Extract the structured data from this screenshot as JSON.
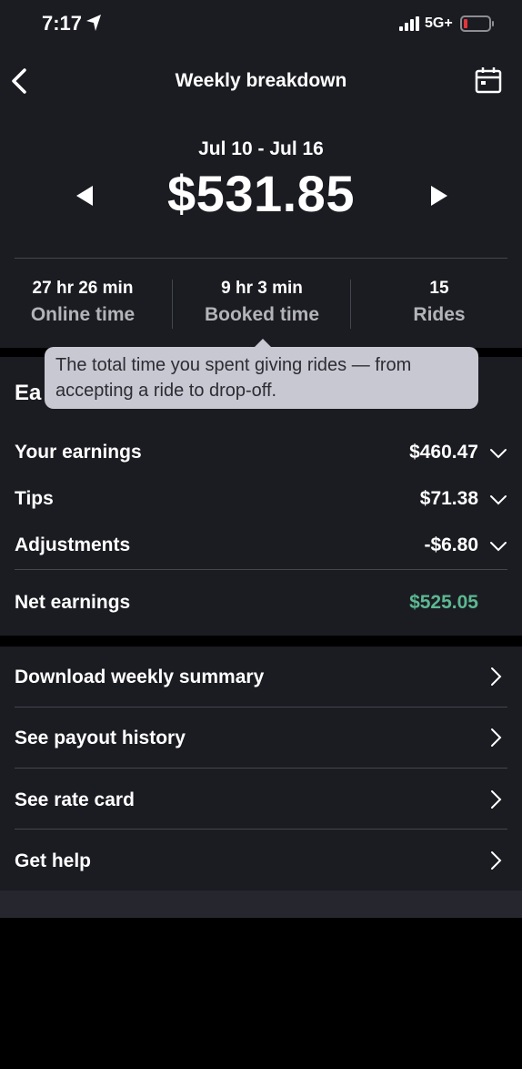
{
  "status": {
    "time": "7:17",
    "network": "5G+"
  },
  "header": {
    "title": "Weekly breakdown"
  },
  "summary": {
    "date_range": "Jul 10 - Jul 16",
    "total": "$531.85"
  },
  "stats": [
    {
      "value": "27 hr 26 min",
      "label": "Online time"
    },
    {
      "value": "9 hr 3 min",
      "label": "Booked time"
    },
    {
      "value": "15",
      "label": "Rides"
    }
  ],
  "tooltip": {
    "text": "The total time you spent giving rides — from accepting a ride to drop-off."
  },
  "earnings": {
    "title": "Ea",
    "rows": [
      {
        "label": "Your earnings",
        "amount": "$460.47"
      },
      {
        "label": "Tips",
        "amount": "$71.38"
      },
      {
        "label": "Adjustments",
        "amount": "-$6.80"
      }
    ],
    "net": {
      "label": "Net earnings",
      "amount": "$525.05"
    }
  },
  "links": [
    {
      "label": "Download weekly summary"
    },
    {
      "label": "See payout history"
    },
    {
      "label": "See rate card"
    },
    {
      "label": "Get help"
    }
  ],
  "colors": {
    "background": "#1b1c22",
    "net_green": "#5cb891",
    "tooltip_bg": "#c8c8d2"
  },
  "icons": [
    "location-arrow-icon",
    "signal-icon",
    "battery-low-icon",
    "back-icon",
    "calendar-icon",
    "triangle-left-icon",
    "triangle-right-icon",
    "chevron-down-icon",
    "chevron-right-icon"
  ]
}
